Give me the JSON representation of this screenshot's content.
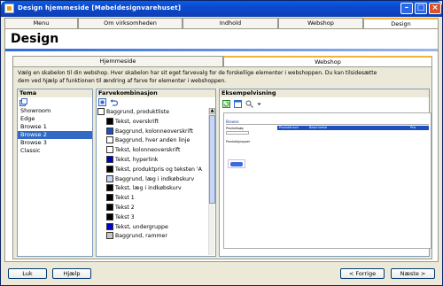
{
  "window": {
    "title": "Design hjemmeside [Møbeldesignvarehuset]"
  },
  "tabs": [
    "Menu",
    "Om virksomheden",
    "Indhold",
    "Webshop",
    "Design"
  ],
  "active_tab": "Design",
  "page_title": "Design",
  "subtabs": [
    "Hjemmeside",
    "Webshop"
  ],
  "active_subtab": "Webshop",
  "description": "Vælg en skabelon til din webshop. Hver skabelon har sit eget farvevalg for de forskellige elementer i webshoppen. Du kan tilsidesætte dem ved hjælp af funktionen til ændring af farve for elementer i webshoppen.",
  "theme": {
    "header": "Tema",
    "items": [
      "Showroom",
      "Edge",
      "Browse 1",
      "Browse 2",
      "Browse 3",
      "Classic"
    ],
    "selected": "Browse 2"
  },
  "colors": {
    "header": "Farvekombinasjon",
    "items": [
      {
        "label": "Baggrund, produktliste",
        "color": "#ffffff"
      },
      {
        "label": "Tekst, overskrift",
        "color": "#000000"
      },
      {
        "label": "Baggrund, kolonneoverskrift",
        "color": "#1f4fbf"
      },
      {
        "label": "Baggrund, hver anden linje",
        "color": "#ffffff"
      },
      {
        "label": "Tekst, kolonneoverskrift",
        "color": "#ffffff"
      },
      {
        "label": "Tekst, hyperlink",
        "color": "#0000cc"
      },
      {
        "label": "Tekst, produktpris og teksten 'A",
        "color": "#000000"
      },
      {
        "label": "Baggrund, læg i indkøbskurv",
        "color": "#c8d6f4"
      },
      {
        "label": "Tekst, læg i indkøbskurv",
        "color": "#000000"
      },
      {
        "label": "Tekst 1",
        "color": "#000000"
      },
      {
        "label": "Tekst 2",
        "color": "#000000"
      },
      {
        "label": "Tekst 3",
        "color": "#000000"
      },
      {
        "label": "Tekst, undergruppe",
        "color": "#0000cc"
      },
      {
        "label": "Baggrund, rammer",
        "color": "#c8c8c8"
      }
    ]
  },
  "preview": {
    "header": "Eksempelvisning",
    "tab_label": "Browse",
    "text1": "Produktsøg",
    "text2": "Produktgrupper",
    "bar_labels": [
      "Produktnavn",
      "Beskrivelse",
      "Pris"
    ]
  },
  "buttons": {
    "close": "Luk",
    "help": "Hjælp",
    "prev": "< Forrige",
    "next": "Næste >"
  }
}
